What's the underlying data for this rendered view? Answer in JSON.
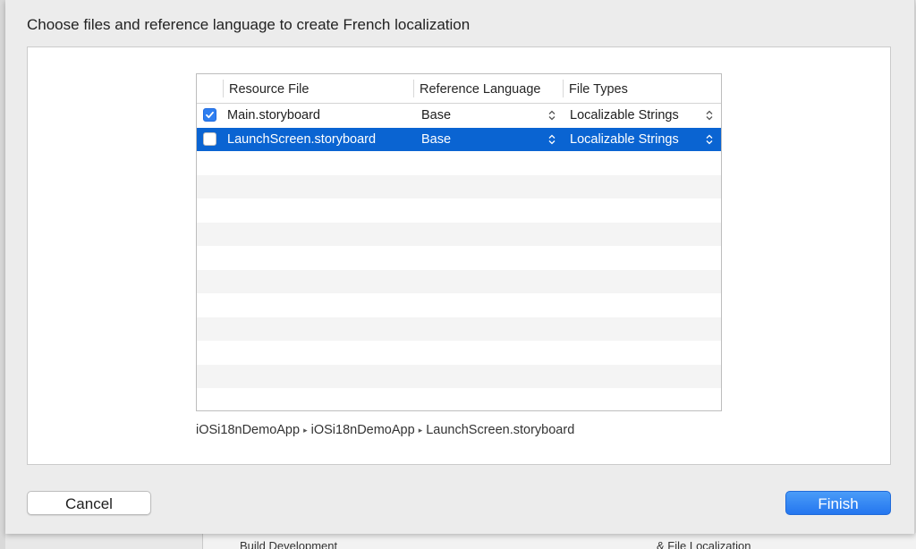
{
  "sheet": {
    "title": "Choose files and reference language to create French localization"
  },
  "table": {
    "columns": [
      "Resource File",
      "Reference Language",
      "File Types"
    ],
    "rows": [
      {
        "checked": true,
        "file": "Main.storyboard",
        "language": "Base",
        "type": "Localizable Strings",
        "selected": false
      },
      {
        "checked": false,
        "file": "LaunchScreen.storyboard",
        "language": "Base",
        "type": "Localizable Strings",
        "selected": true
      }
    ],
    "selection_color": "#0a64d2"
  },
  "path": {
    "segments": [
      "iOSi18nDemoApp",
      "iOSi18nDemoApp",
      "LaunchScreen.storyboard"
    ]
  },
  "buttons": {
    "cancel": "Cancel",
    "finish": "Finish"
  },
  "background": {
    "bottom_left_text": "Build  Development",
    "bottom_right_text": "& File Localization"
  },
  "colors": {
    "accent": "#2476ef",
    "checkbox": "#2e7ef0"
  }
}
